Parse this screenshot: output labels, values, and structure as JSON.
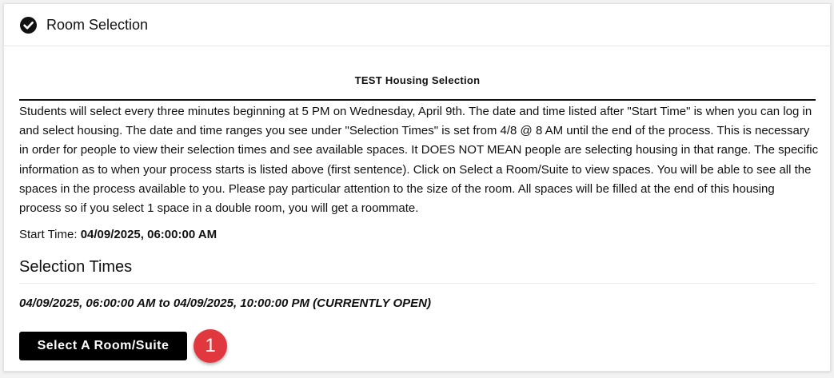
{
  "header": {
    "title": "Room Selection",
    "icon": "check-circle-icon"
  },
  "section": {
    "heading": "TEST Housing Selection",
    "description": "Students will select every three minutes beginning at 5 PM on Wednesday, April 9th. The date and time listed after \"Start Time\" is when you can log in and select housing. The date and time ranges you see under \"Selection Times\" is set from 4/8 @ 8 AM until the end of the process. This is necessary in order for people to view their selection times and see available spaces. It DOES NOT MEAN people are selecting housing in that range. The specific information as to when your process starts is listed above (first sentence). Click on Select a Room/Suite to view spaces. You will be able to see all the spaces in the process available to you. Please pay particular attention to the size of the room. All spaces will be filled at the end of this housing process so if you select 1 space in a double room, you will get a roommate."
  },
  "start_time": {
    "label": "Start Time:",
    "value": "04/09/2025, 06:00:00 AM"
  },
  "selection_times": {
    "title": "Selection Times",
    "range": "04/09/2025, 06:00:00 AM to 04/09/2025, 10:00:00 PM (CURRENTLY OPEN)"
  },
  "actions": {
    "select_label": "Select A Room/Suite"
  },
  "annotation": {
    "badge_number": "1",
    "badge_color": "#e0383e"
  }
}
